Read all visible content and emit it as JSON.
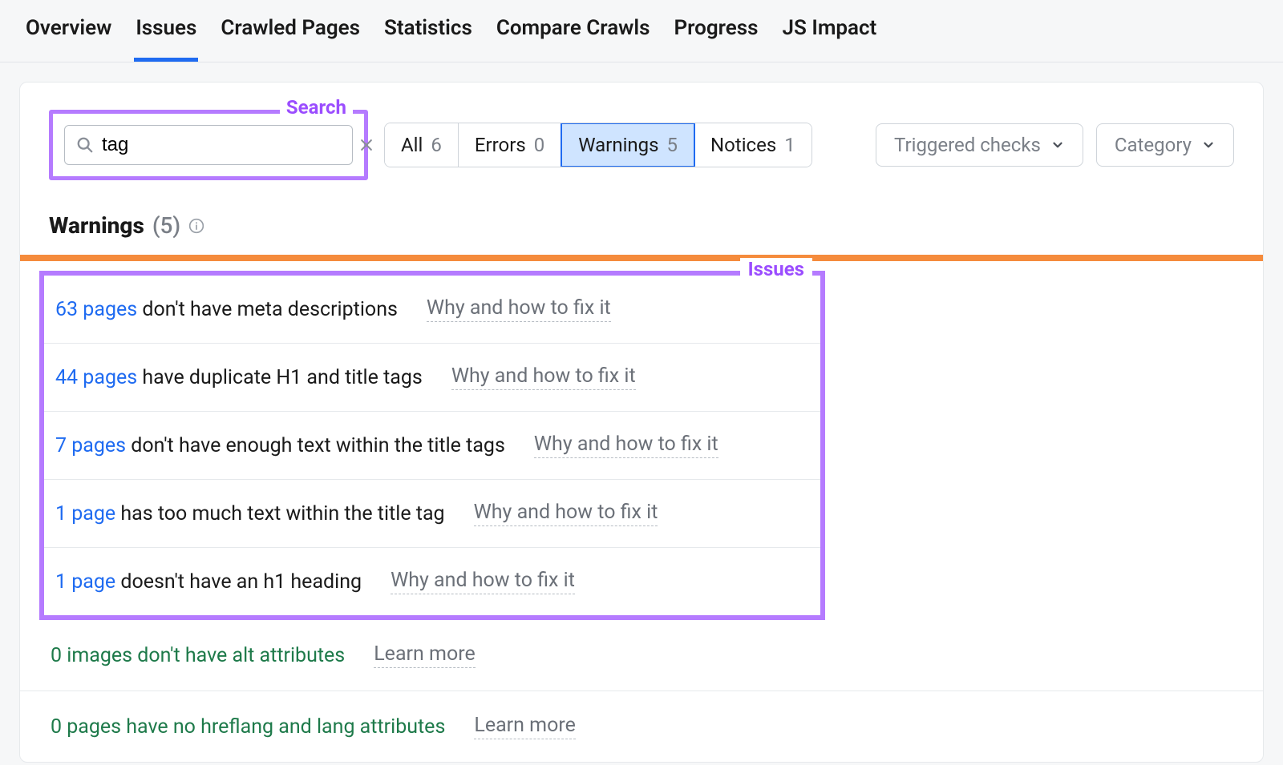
{
  "tabs": [
    {
      "label": "Overview",
      "active": false
    },
    {
      "label": "Issues",
      "active": true
    },
    {
      "label": "Crawled Pages",
      "active": false
    },
    {
      "label": "Statistics",
      "active": false
    },
    {
      "label": "Compare Crawls",
      "active": false
    },
    {
      "label": "Progress",
      "active": false
    },
    {
      "label": "JS Impact",
      "active": false
    }
  ],
  "annotations": {
    "search": "Search",
    "issues": "Issues"
  },
  "search": {
    "value": "tag"
  },
  "filters": [
    {
      "label": "All",
      "count": "6",
      "active": false
    },
    {
      "label": "Errors",
      "count": "0",
      "active": false
    },
    {
      "label": "Warnings",
      "count": "5",
      "active": true
    },
    {
      "label": "Notices",
      "count": "1",
      "active": false
    }
  ],
  "dropdowns": {
    "triggered": "Triggered checks",
    "category": "Category"
  },
  "section": {
    "title": "Warnings",
    "count": "(5)"
  },
  "issues": [
    {
      "link": "63 pages",
      "text": " don't have meta descriptions",
      "fix": "Why and how to fix it"
    },
    {
      "link": "44 pages",
      "text": " have duplicate H1 and title tags",
      "fix": "Why and how to fix it"
    },
    {
      "link": "7 pages",
      "text": " don't have enough text within the title tags",
      "fix": "Why and how to fix it"
    },
    {
      "link": "1 page",
      "text": " has too much text within the title tag",
      "fix": "Why and how to fix it"
    },
    {
      "link": "1 page",
      "text": " doesn't have an h1 heading",
      "fix": "Why and how to fix it"
    }
  ],
  "passed": [
    {
      "text": "0 images don't have alt attributes",
      "learn": "Learn more"
    },
    {
      "text": "0 pages have no hreflang and lang attributes",
      "learn": "Learn more"
    }
  ]
}
